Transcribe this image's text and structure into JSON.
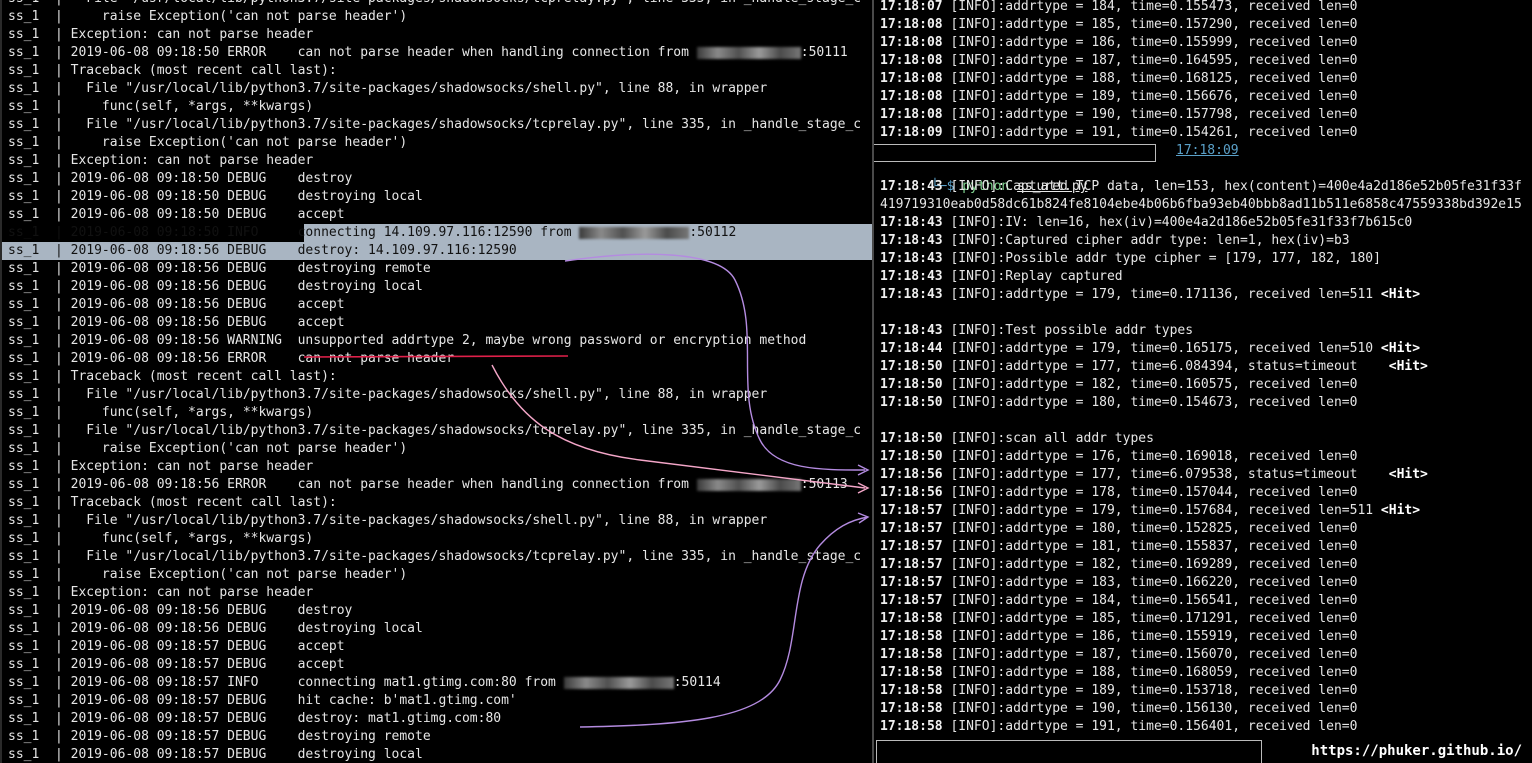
{
  "left_log": [
    {
      "p": "ss_1  |   ",
      "t": "File \"/usr/local/lib/python3.7/site-packages/shadowsocks/tcprelay.py\", line 335, in _handle_stage_c"
    },
    {
      "p": "ss_1  |   ",
      "t": "  raise Exception('can not parse header')"
    },
    {
      "p": "ss_1  | ",
      "t": "Exception: can not parse header"
    },
    {
      "p": "ss_1  | ",
      "t": "2019-06-08 09:18:50 ERROR    can not parse header when handling connection from ",
      "blur": 104,
      "after": ":50111"
    },
    {
      "p": "ss_1  | ",
      "t": "Traceback (most recent call last):"
    },
    {
      "p": "ss_1  |   ",
      "t": "File \"/usr/local/lib/python3.7/site-packages/shadowsocks/shell.py\", line 88, in wrapper"
    },
    {
      "p": "ss_1  |   ",
      "t": "  func(self, *args, **kwargs)"
    },
    {
      "p": "ss_1  |   ",
      "t": "File \"/usr/local/lib/python3.7/site-packages/shadowsocks/tcprelay.py\", line 335, in _handle_stage_c"
    },
    {
      "p": "ss_1  |   ",
      "t": "  raise Exception('can not parse header')"
    },
    {
      "p": "ss_1  | ",
      "t": "Exception: can not parse header"
    },
    {
      "p": "ss_1  | ",
      "t": "2019-06-08 09:18:50 DEBUG    destroy"
    },
    {
      "p": "ss_1  | ",
      "t": "2019-06-08 09:18:50 DEBUG    destroying local"
    },
    {
      "p": "ss_1  | ",
      "t": "2019-06-08 09:18:50 DEBUG    accept"
    },
    {
      "p": "ss_1  | ",
      "t": "2019-06-08 09:18:50 INFO     connecting 14.109.97.116:12590 from ",
      "blur": 110,
      "after": ":50112",
      "hl": "partial"
    },
    {
      "p": "ss_1  | ",
      "t": "2019-06-08 09:18:56 DEBUG    destroy: 14.109.97.116:12590",
      "hl": "full"
    },
    {
      "p": "ss_1  | ",
      "t": "2019-06-08 09:18:56 DEBUG    destroying remote"
    },
    {
      "p": "ss_1  | ",
      "t": "2019-06-08 09:18:56 DEBUG    destroying local"
    },
    {
      "p": "ss_1  | ",
      "t": "2019-06-08 09:18:56 DEBUG    accept"
    },
    {
      "p": "ss_1  | ",
      "t": "2019-06-08 09:18:56 DEBUG    accept"
    },
    {
      "p": "ss_1  | ",
      "t": "2019-06-08 09:18:56 WARNING  unsupported addrtype 2, maybe wrong password or encryption method"
    },
    {
      "p": "ss_1  | ",
      "t": "2019-06-08 09:18:56 ERROR    can not parse header"
    },
    {
      "p": "ss_1  | ",
      "t": "Traceback (most recent call last):"
    },
    {
      "p": "ss_1  |   ",
      "t": "File \"/usr/local/lib/python3.7/site-packages/shadowsocks/shell.py\", line 88, in wrapper"
    },
    {
      "p": "ss_1  |   ",
      "t": "  func(self, *args, **kwargs)"
    },
    {
      "p": "ss_1  |   ",
      "t": "File \"/usr/local/lib/python3.7/site-packages/shadowsocks/tcprelay.py\", line 335, in _handle_stage_c"
    },
    {
      "p": "ss_1  |   ",
      "t": "  raise Exception('can not parse header')"
    },
    {
      "p": "ss_1  | ",
      "t": "Exception: can not parse header"
    },
    {
      "p": "ss_1  | ",
      "t": "2019-06-08 09:18:56 ERROR    can not parse header when handling connection from ",
      "blur": 104,
      "after": ":50113"
    },
    {
      "p": "ss_1  | ",
      "t": "Traceback (most recent call last):"
    },
    {
      "p": "ss_1  |   ",
      "t": "File \"/usr/local/lib/python3.7/site-packages/shadowsocks/shell.py\", line 88, in wrapper"
    },
    {
      "p": "ss_1  |   ",
      "t": "  func(self, *args, **kwargs)"
    },
    {
      "p": "ss_1  |   ",
      "t": "File \"/usr/local/lib/python3.7/site-packages/shadowsocks/tcprelay.py\", line 335, in _handle_stage_c"
    },
    {
      "p": "ss_1  |   ",
      "t": "  raise Exception('can not parse header')"
    },
    {
      "p": "ss_1  | ",
      "t": "Exception: can not parse header"
    },
    {
      "p": "ss_1  | ",
      "t": "2019-06-08 09:18:56 DEBUG    destroy"
    },
    {
      "p": "ss_1  | ",
      "t": "2019-06-08 09:18:56 DEBUG    destroying local"
    },
    {
      "p": "ss_1  | ",
      "t": "2019-06-08 09:18:57 DEBUG    accept"
    },
    {
      "p": "ss_1  | ",
      "t": "2019-06-08 09:18:57 DEBUG    accept"
    },
    {
      "p": "ss_1  | ",
      "t": "2019-06-08 09:18:57 INFO     connecting mat1.gtimg.com:80 from ",
      "blur": 110,
      "after": ":50114"
    },
    {
      "p": "ss_1  | ",
      "t": "2019-06-08 09:18:57 DEBUG    hit cache: b'mat1.gtimg.com'"
    },
    {
      "p": "ss_1  | ",
      "t": "2019-06-08 09:18:57 DEBUG    destroy: mat1.gtimg.com:80"
    },
    {
      "p": "ss_1  | ",
      "t": "2019-06-08 09:18:57 DEBUG    destroying remote"
    },
    {
      "p": "ss_1  | ",
      "t": "2019-06-08 09:18:57 DEBUG    destroying local"
    }
  ],
  "right_top": [
    {
      "ts": "17:18:07",
      "t": " [INFO]:addrtype = 184, time=0.155473, received len=0"
    },
    {
      "ts": "17:18:08",
      "t": " [INFO]:addrtype = 185, time=0.157290, received len=0"
    },
    {
      "ts": "17:18:08",
      "t": " [INFO]:addrtype = 186, time=0.155999, received len=0"
    },
    {
      "ts": "17:18:08",
      "t": " [INFO]:addrtype = 187, time=0.164595, received len=0"
    },
    {
      "ts": "17:18:08",
      "t": " [INFO]:addrtype = 188, time=0.168125, received len=0"
    },
    {
      "ts": "17:18:08",
      "t": " [INFO]:addrtype = 189, time=0.156676, received len=0"
    },
    {
      "ts": "17:18:08",
      "t": " [INFO]:addrtype = 190, time=0.157798, received len=0"
    },
    {
      "ts": "17:18:09",
      "t": " [INFO]:addrtype = 191, time=0.154261, received len=0"
    }
  ],
  "prompt": {
    "time": "17:18:09",
    "arrow": "└─$ ",
    "cmd": "python",
    "arg": "ss_att.py"
  },
  "right_bottom": [
    {
      "ts": "17:18:43",
      "t": " [INFO]:Captured TCP data, len=153, hex(content)=400e4a2d186e52b05fe31f33f"
    },
    {
      "ts": "",
      "t": "419719310eab0d58dc61b824fe8104ebe4b06b6fba93eb40bbb8ad11b511e6858c47559338bd392e15"
    },
    {
      "ts": "17:18:43",
      "t": " [INFO]:IV: len=16, hex(iv)=400e4a2d186e52b05fe31f33f7b615c0"
    },
    {
      "ts": "17:18:43",
      "t": " [INFO]:Captured cipher addr type: len=1, hex(iv)=b3"
    },
    {
      "ts": "17:18:43",
      "t": " [INFO]:Possible addr type cipher = [179, 177, 182, 180]"
    },
    {
      "ts": "17:18:43",
      "t": " [INFO]:Replay captured"
    },
    {
      "ts": "17:18:43",
      "t": " [INFO]:addrtype = 179, time=0.171136, received len=511 ",
      "hit": "<Hit>"
    },
    {
      "blank": true
    },
    {
      "ts": "17:18:43",
      "t": " [INFO]:Test possible addr types"
    },
    {
      "ts": "17:18:44",
      "t": " [INFO]:addrtype = 179, time=0.165175, received len=510 ",
      "hit": "<Hit>"
    },
    {
      "ts": "17:18:50",
      "t": " [INFO]:addrtype = 177, time=6.084394, status=timeout    ",
      "hit": "<Hit>"
    },
    {
      "ts": "17:18:50",
      "t": " [INFO]:addrtype = 182, time=0.160575, received len=0"
    },
    {
      "ts": "17:18:50",
      "t": " [INFO]:addrtype = 180, time=0.154673, received len=0"
    },
    {
      "blank": true
    },
    {
      "ts": "17:18:50",
      "t": " [INFO]:scan all addr types"
    },
    {
      "ts": "17:18:50",
      "t": " [INFO]:addrtype = 176, time=0.169018, received len=0"
    },
    {
      "ts": "17:18:56",
      "t": " [INFO]:addrtype = 177, time=6.079538, status=timeout    ",
      "hit": "<Hit>"
    },
    {
      "ts": "17:18:56",
      "t": " [INFO]:addrtype = 178, time=0.157044, received len=0"
    },
    {
      "ts": "17:18:57",
      "t": " [INFO]:addrtype = 179, time=0.157684, received len=511 ",
      "hit": "<Hit>"
    },
    {
      "ts": "17:18:57",
      "t": " [INFO]:addrtype = 180, time=0.152825, received len=0"
    },
    {
      "ts": "17:18:57",
      "t": " [INFO]:addrtype = 181, time=0.155837, received len=0"
    },
    {
      "ts": "17:18:57",
      "t": " [INFO]:addrtype = 182, time=0.169289, received len=0"
    },
    {
      "ts": "17:18:57",
      "t": " [INFO]:addrtype = 183, time=0.166220, received len=0"
    },
    {
      "ts": "17:18:57",
      "t": " [INFO]:addrtype = 184, time=0.156541, received len=0"
    },
    {
      "ts": "17:18:58",
      "t": " [INFO]:addrtype = 185, time=0.171291, received len=0"
    },
    {
      "ts": "17:18:58",
      "t": " [INFO]:addrtype = 186, time=0.155919, received len=0"
    },
    {
      "ts": "17:18:58",
      "t": " [INFO]:addrtype = 187, time=0.156070, received len=0"
    },
    {
      "ts": "17:18:58",
      "t": " [INFO]:addrtype = 188, time=0.168059, received len=0"
    },
    {
      "ts": "17:18:58",
      "t": " [INFO]:addrtype = 189, time=0.153718, received len=0"
    },
    {
      "ts": "17:18:58",
      "t": " [INFO]:addrtype = 190, time=0.156130, received len=0"
    },
    {
      "ts": "17:18:58",
      "t": " [INFO]:addrtype = 191, time=0.156401, received len=0"
    }
  ],
  "watermark": "https://phuker.github.io/",
  "colors": {
    "highlight": "#a9b5c2",
    "underline": "#e0204a",
    "arrow_pink": "#f4a6c8",
    "arrow_violet": "#b48be0",
    "prompt_cyan": "#5aa0c8",
    "prompt_green": "#7fd38f"
  }
}
